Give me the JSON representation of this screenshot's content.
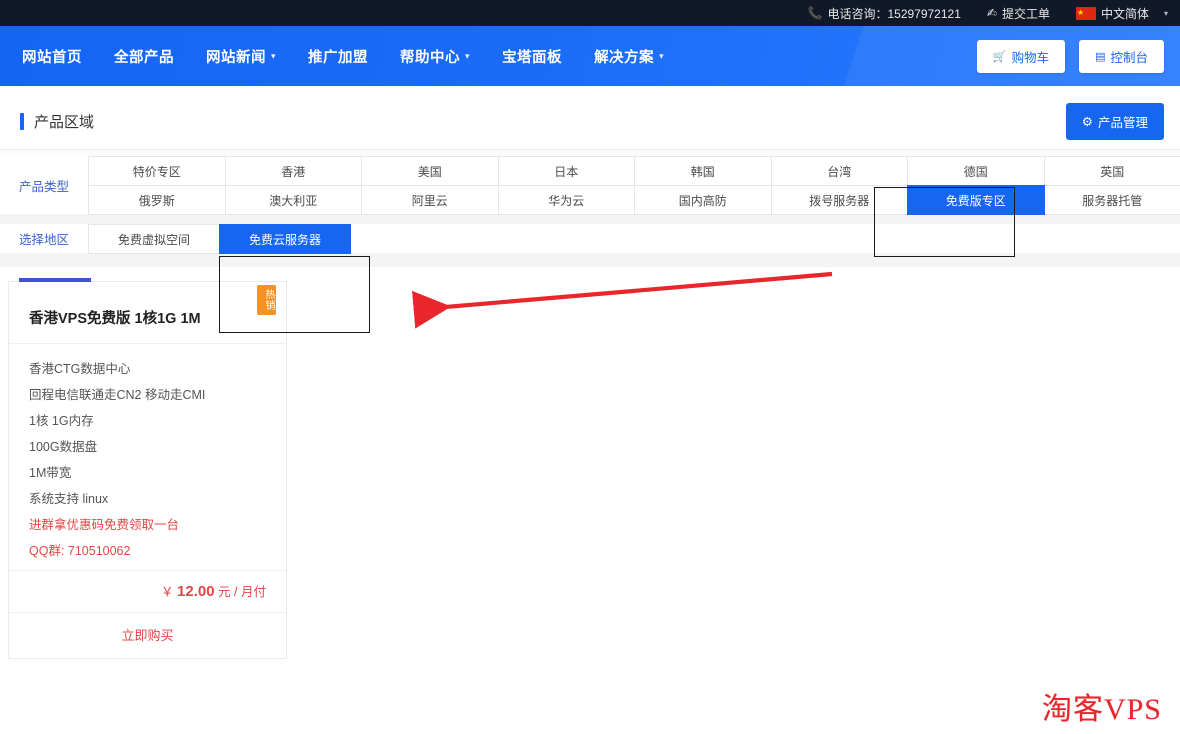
{
  "topbar": {
    "phone_icon": "phone-icon",
    "phone_label": "电话咨询：15297972121",
    "ticket_icon": "edit-ticket-icon",
    "ticket_label": "提交工单",
    "flag_icon": "china-flag-icon",
    "language_label": "中文简体",
    "language_caret": "▾"
  },
  "nav": {
    "items": [
      {
        "label": "网站首页",
        "has_caret": false
      },
      {
        "label": "全部产品",
        "has_caret": false
      },
      {
        "label": "网站新闻",
        "has_caret": true
      },
      {
        "label": "推广加盟",
        "has_caret": false
      },
      {
        "label": "帮助中心",
        "has_caret": true
      },
      {
        "label": "宝塔面板",
        "has_caret": false
      },
      {
        "label": "解决方案",
        "has_caret": true
      }
    ],
    "caret_glyph": "▾",
    "buttons": [
      {
        "icon": "cart-icon",
        "glyph": "🛒",
        "label": "购物车"
      },
      {
        "icon": "console-icon",
        "glyph": "▤",
        "label": "控制台"
      }
    ]
  },
  "section": {
    "title": "产品区域",
    "manage_icon": "gear-icon",
    "manage_glyph": "⚙",
    "manage_label": "产品管理"
  },
  "filters": {
    "product_type": {
      "label": "产品类型",
      "row1": [
        "特价专区",
        "香港",
        "美国",
        "日本",
        "韩国",
        "台湾",
        "德国",
        "英国"
      ],
      "row2": [
        "俄罗斯",
        "澳大利亚",
        "阿里云",
        "华为云",
        "国内高防",
        "拨号服务器",
        "免费版专区",
        "服务器托管"
      ],
      "selected": "免费版专区"
    },
    "region": {
      "label": "选择地区",
      "options": [
        "免费虚拟空间",
        "免费云服务器"
      ],
      "selected": "免费云服务器"
    }
  },
  "annotations": {
    "rect_product_type": "黑色方框标注 免费版专区",
    "rect_region": "黑色方框标注 免费云服务器",
    "arrow_color": "#e8262b"
  },
  "product_card": {
    "badge": "热销",
    "title": "香港VPS免费版 1核1G 1M",
    "specs": [
      {
        "text": "香港CTG数据中心",
        "style": "normal"
      },
      {
        "text": "回程电信联通走CN2 移动走CMI",
        "style": "normal"
      },
      {
        "text": "1核 1G内存",
        "style": "normal"
      },
      {
        "text": "100G数据盘",
        "style": "normal"
      },
      {
        "text": "1M带宽",
        "style": "normal"
      },
      {
        "text": "系统支持 linux",
        "style": "normal"
      },
      {
        "text": "进群拿优惠码免费领取一台",
        "style": "promo"
      },
      {
        "text": "QQ群: 710510062",
        "style": "qq"
      }
    ],
    "price_currency": "￥",
    "price_amount": "12.00",
    "price_unit": "元 / 月付",
    "buy_label": "立即购买"
  },
  "watermark": {
    "text": "淘客VPS",
    "color": "#e8262b"
  }
}
